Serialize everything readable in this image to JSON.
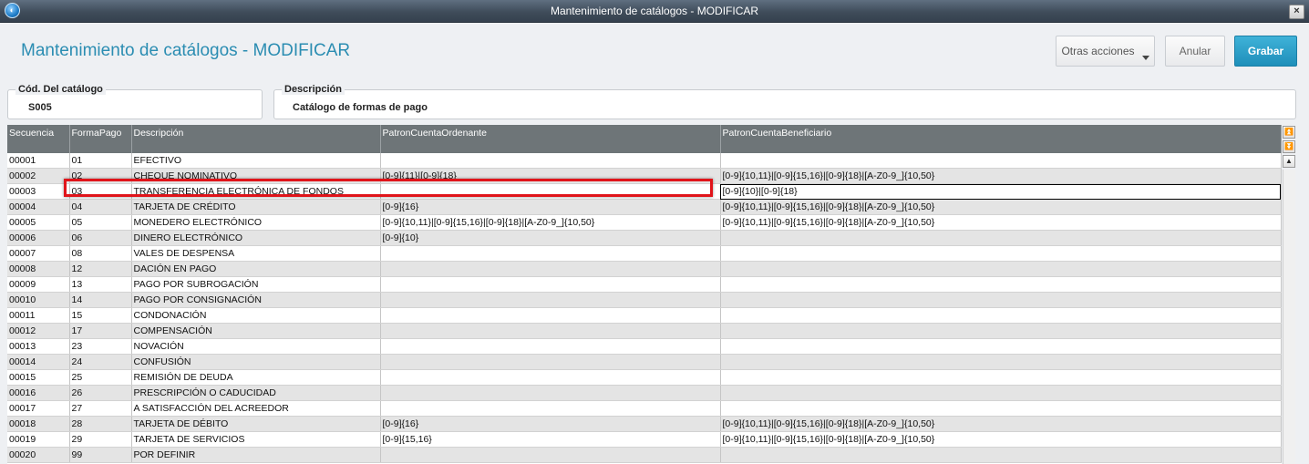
{
  "window": {
    "title": "Mantenimiento de catálogos - MODIFICAR",
    "close_label": "×"
  },
  "header": {
    "title": "Mantenimiento de catálogos - MODIFICAR",
    "buttons": {
      "otras": "Otras acciones",
      "anular": "Anular",
      "grabar": "Grabar"
    }
  },
  "fields": {
    "codigo": {
      "label": "Cód. Del catálogo",
      "value": "S005"
    },
    "descripcion": {
      "label": "Descripción",
      "value": "Catálogo de formas de pago"
    }
  },
  "grid": {
    "columns": [
      "Secuencia",
      "FormaPago",
      "Descripción",
      "PatronCuentaOrdenante",
      "PatronCuentaBeneficiario"
    ],
    "selected_row": "00003",
    "rows": [
      [
        "00001",
        "01",
        "EFECTIVO",
        "",
        ""
      ],
      [
        "00002",
        "02",
        "CHEQUE NOMINATIVO",
        "[0-9]{11}|[0-9]{18}",
        "[0-9]{10,11}|[0-9]{15,16}|[0-9]{18}|[A-Z0-9_]{10,50}"
      ],
      [
        "00003",
        "03",
        "TRANSFERENCIA ELECTRÓNICA DE FONDOS",
        "",
        "[0-9]{10}|[0-9]{18}"
      ],
      [
        "00004",
        "04",
        "TARJETA DE CRÉDITO",
        "[0-9]{16}",
        "[0-9]{10,11}|[0-9]{15,16}|[0-9]{18}|[A-Z0-9_]{10,50}"
      ],
      [
        "00005",
        "05",
        "MONEDERO ELECTRÓNICO",
        "[0-9]{10,11}|[0-9]{15,16}|[0-9]{18}|[A-Z0-9_]{10,50}",
        "[0-9]{10,11}|[0-9]{15,16}|[0-9]{18}|[A-Z0-9_]{10,50}"
      ],
      [
        "00006",
        "06",
        "DINERO ELECTRÓNICO",
        "[0-9]{10}",
        ""
      ],
      [
        "00007",
        "08",
        "VALES DE DESPENSA",
        "",
        ""
      ],
      [
        "00008",
        "12",
        "DACIÓN EN PAGO",
        "",
        ""
      ],
      [
        "00009",
        "13",
        "PAGO POR SUBROGACIÓN",
        "",
        ""
      ],
      [
        "00010",
        "14",
        "PAGO POR CONSIGNACIÓN",
        "",
        ""
      ],
      [
        "00011",
        "15",
        "CONDONACIÓN",
        "",
        ""
      ],
      [
        "00012",
        "17",
        "COMPENSACIÓN",
        "",
        ""
      ],
      [
        "00013",
        "23",
        "NOVACIÓN",
        "",
        ""
      ],
      [
        "00014",
        "24",
        "CONFUSIÓN",
        "",
        ""
      ],
      [
        "00015",
        "25",
        "REMISIÓN DE DEUDA",
        "",
        ""
      ],
      [
        "00016",
        "26",
        "PRESCRIPCIÓN O CADUCIDAD",
        "",
        ""
      ],
      [
        "00017",
        "27",
        "A SATISFACCIÓN DEL ACREEDOR",
        "",
        ""
      ],
      [
        "00018",
        "28",
        "TARJETA DE DÉBITO",
        "[0-9]{16}",
        "[0-9]{10,11}|[0-9]{15,16}|[0-9]{18}|[A-Z0-9_]{10,50}"
      ],
      [
        "00019",
        "29",
        "TARJETA DE SERVICIOS",
        "[0-9]{15,16}",
        "[0-9]{10,11}|[0-9]{15,16}|[0-9]{18}|[A-Z0-9_]{10,50}"
      ],
      [
        "00020",
        "99",
        "POR DEFINIR",
        "",
        ""
      ]
    ]
  },
  "icons": {
    "app": "app-logo-icon",
    "scroll_top": "scroll-top-icon",
    "scroll_bottom": "scroll-bottom-icon",
    "scroll_up": "scroll-up-icon",
    "dropdown": "chevron-down-icon"
  },
  "colors": {
    "accent": "#2b8db2",
    "primary_button": "#1e8fba",
    "highlight": "#e0141a",
    "grid_header": "#6e7578"
  }
}
